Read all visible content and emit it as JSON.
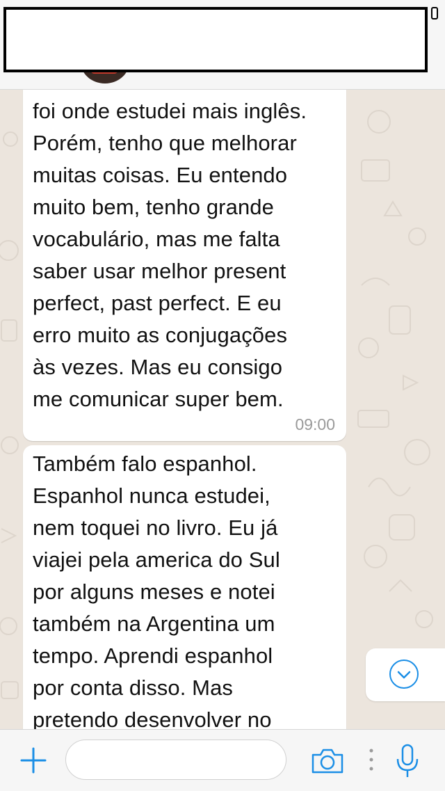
{
  "header": {
    "title": ""
  },
  "messages": [
    {
      "text": "foi onde estudei mais inglês.\nPorém, tenho que melhorar\nmuitas coisas. Eu entendo\nmuito bem, tenho grande\nvocabulário, mas me falta\nsaber usar melhor present\nperfect, past perfect. E eu\nerro muito as conjugações\nàs vezes. Mas eu consigo\nme comunicar super bem.",
      "time": "09:00"
    },
    {
      "text": "Também falo espanhol.\nEspanhol nunca estudei,\nnem toquei no livro. Eu já\nviajei pela america do Sul\npor alguns meses e notei\ntambém na Argentina um\ntempo. Aprendi espanhol\npor conta disso. Mas\npretendo desenvolver no",
      "time": ""
    }
  ],
  "input": {
    "value": "",
    "placeholder": ""
  },
  "icons": {
    "attach": "plus-icon",
    "camera": "camera-icon",
    "more": "more-dots-icon",
    "mic": "microphone-icon",
    "scroll_down": "chevron-down-icon"
  },
  "colors": {
    "accent": "#1a8ee6",
    "wallpaper": "#ece5dd",
    "bubble": "#ffffff"
  }
}
